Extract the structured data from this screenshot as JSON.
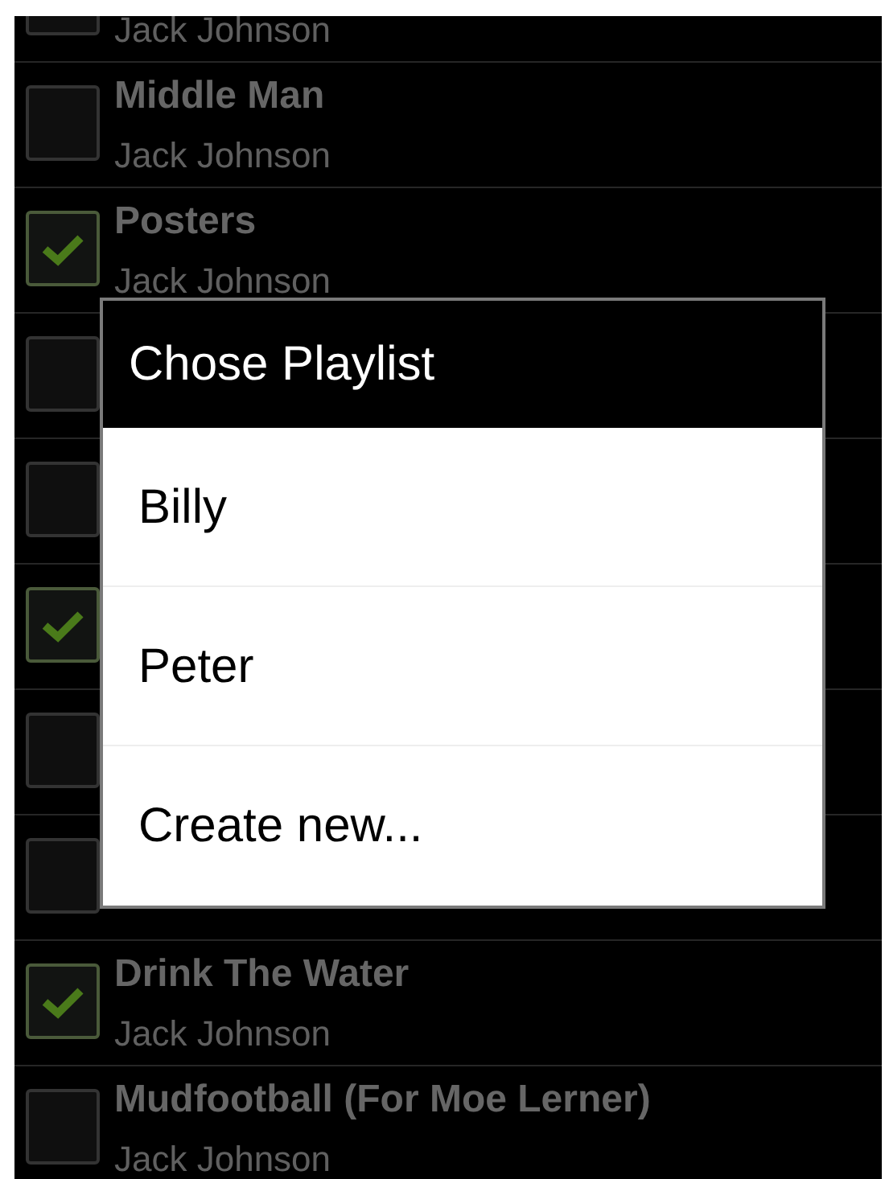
{
  "songs": [
    {
      "artist": "Jack Johnson",
      "checked": false
    },
    {
      "title": "Middle Man",
      "artist": "Jack Johnson",
      "checked": false
    },
    {
      "title": "Posters",
      "artist": "Jack Johnson",
      "checked": true
    },
    {
      "checked": false
    },
    {
      "checked": false
    },
    {
      "checked": true
    },
    {
      "checked": false
    },
    {
      "checked": false
    },
    {
      "title": "Drink The Water",
      "artist": "Jack Johnson",
      "checked": true
    },
    {
      "title": "Mudfootball (For Moe Lerner)",
      "artist": "Jack Johnson",
      "checked": false
    }
  ],
  "dialog": {
    "title": "Chose Playlist",
    "items": [
      "Billy",
      "Peter",
      "Create new..."
    ]
  }
}
